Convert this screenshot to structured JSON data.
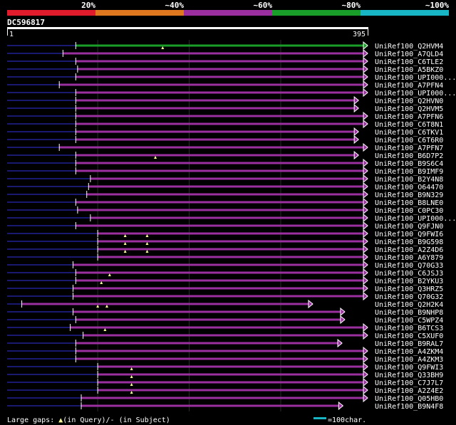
{
  "header": {
    "pct_labels": [
      "20%",
      "~40%",
      "~60%",
      "~80%",
      "~100%"
    ],
    "pct_colors": [
      "#e01b2c",
      "#e07820",
      "#9b2fa0",
      "#1a9e2a",
      "#18b5c5"
    ],
    "query_id": "DC596817",
    "ruler_start": "1",
    "ruler_end": "395"
  },
  "footer": {
    "gaps_prefix": "Large gaps: ",
    "gaps_query": "(in Query)/",
    "gaps_dash": "-",
    "gaps_subject": " (in Subject)",
    "scale_label": "=100char."
  },
  "colors": {
    "hit": "#9b2fa0",
    "best": "#1a9e2a",
    "dim": "#191970",
    "gap": "#ffff99",
    "scale": "#18b5c5"
  },
  "query_length": 395,
  "hits": [
    {
      "name": "UniRef100_Q2HVM4",
      "start": 76,
      "end": 395,
      "gaps": [
        171
      ],
      "best": true
    },
    {
      "name": "UniRef100_A7QLD4",
      "start": 62,
      "end": 395,
      "gaps": []
    },
    {
      "name": "UniRef100_C6TLE2",
      "start": 76,
      "end": 395,
      "gaps": []
    },
    {
      "name": "UniRef100_A5BKZ0",
      "start": 78,
      "end": 395,
      "gaps": []
    },
    {
      "name": "UniRef100_UPI000...",
      "start": 76,
      "end": 395,
      "gaps": []
    },
    {
      "name": "UniRef100_A7PFN4",
      "start": 58,
      "end": 395,
      "gaps": []
    },
    {
      "name": "UniRef100_UPI000...",
      "start": 76,
      "end": 395,
      "gaps": []
    },
    {
      "name": "UniRef100_Q2HVN0",
      "start": 76,
      "end": 385,
      "gaps": []
    },
    {
      "name": "UniRef100_Q2HVM5",
      "start": 76,
      "end": 385,
      "gaps": []
    },
    {
      "name": "UniRef100_A7PFN6",
      "start": 76,
      "end": 395,
      "gaps": []
    },
    {
      "name": "UniRef100_C6T8N1",
      "start": 76,
      "end": 395,
      "gaps": []
    },
    {
      "name": "UniRef100_C6TKV1",
      "start": 76,
      "end": 385,
      "gaps": []
    },
    {
      "name": "UniRef100_C6T6R0",
      "start": 76,
      "end": 385,
      "gaps": []
    },
    {
      "name": "UniRef100_A7PFN7",
      "start": 58,
      "end": 395,
      "gaps": []
    },
    {
      "name": "UniRef100_B6D7P2",
      "start": 76,
      "end": 385,
      "gaps": [
        163
      ]
    },
    {
      "name": "UniRef100_B9S6C4",
      "start": 76,
      "end": 395,
      "gaps": []
    },
    {
      "name": "UniRef100_B9IMF9",
      "start": 76,
      "end": 395,
      "gaps": []
    },
    {
      "name": "UniRef100_B2Y4N8",
      "start": 92,
      "end": 395,
      "gaps": []
    },
    {
      "name": "UniRef100_O64470",
      "start": 90,
      "end": 395,
      "gaps": []
    },
    {
      "name": "UniRef100_B9N329",
      "start": 88,
      "end": 395,
      "gaps": []
    },
    {
      "name": "UniRef100_B8LNE0",
      "start": 76,
      "end": 395,
      "gaps": []
    },
    {
      "name": "UniRef100_C0PC30",
      "start": 78,
      "end": 395,
      "gaps": []
    },
    {
      "name": "UniRef100_UPI000...",
      "start": 92,
      "end": 395,
      "gaps": []
    },
    {
      "name": "UniRef100_Q9FJN0",
      "start": 76,
      "end": 395,
      "gaps": []
    },
    {
      "name": "UniRef100_Q9FWI6",
      "start": 100,
      "end": 395,
      "gaps": [
        130,
        154
      ]
    },
    {
      "name": "UniRef100_B9G598",
      "start": 100,
      "end": 395,
      "gaps": [
        130,
        154
      ]
    },
    {
      "name": "UniRef100_A2Z4D6",
      "start": 100,
      "end": 395,
      "gaps": [
        130,
        154
      ]
    },
    {
      "name": "UniRef100_A6Y879",
      "start": 100,
      "end": 395,
      "gaps": []
    },
    {
      "name": "UniRef100_Q70G33",
      "start": 73,
      "end": 395,
      "gaps": []
    },
    {
      "name": "UniRef100_C6JSJ3",
      "start": 76,
      "end": 395,
      "gaps": [
        113
      ]
    },
    {
      "name": "UniRef100_B2YKU3",
      "start": 76,
      "end": 395,
      "gaps": [
        104
      ]
    },
    {
      "name": "UniRef100_Q3HRZ5",
      "start": 73,
      "end": 395,
      "gaps": []
    },
    {
      "name": "UniRef100_Q70G32",
      "start": 73,
      "end": 395,
      "gaps": []
    },
    {
      "name": "UniRef100_Q2H2K4",
      "start": 17,
      "end": 335,
      "gaps": [
        100,
        110
      ]
    },
    {
      "name": "UniRef100_B9NHP8",
      "start": 73,
      "end": 370,
      "gaps": []
    },
    {
      "name": "UniRef100_C5WPZ4",
      "start": 76,
      "end": 370,
      "gaps": []
    },
    {
      "name": "UniRef100_B6TCS3",
      "start": 70,
      "end": 395,
      "gaps": [
        108
      ]
    },
    {
      "name": "UniRef100_C5XUF0",
      "start": 84,
      "end": 395,
      "gaps": []
    },
    {
      "name": "UniRef100_B9RAL7",
      "start": 76,
      "end": 367,
      "gaps": []
    },
    {
      "name": "UniRef100_A4ZKM4",
      "start": 76,
      "end": 395,
      "gaps": []
    },
    {
      "name": "UniRef100_A4ZKM3",
      "start": 76,
      "end": 395,
      "gaps": []
    },
    {
      "name": "UniRef100_Q9FWI3",
      "start": 100,
      "end": 395,
      "gaps": [
        137
      ]
    },
    {
      "name": "UniRef100_Q33BH9",
      "start": 100,
      "end": 395,
      "gaps": [
        137
      ]
    },
    {
      "name": "UniRef100_C7J7L7",
      "start": 100,
      "end": 395,
      "gaps": [
        137
      ]
    },
    {
      "name": "UniRef100_A2Z4E2",
      "start": 100,
      "end": 395,
      "gaps": [
        137
      ]
    },
    {
      "name": "UniRef100_Q05HB0",
      "start": 82,
      "end": 395,
      "gaps": []
    },
    {
      "name": "UniRef100_B9N4F8",
      "start": 82,
      "end": 368,
      "gaps": []
    }
  ]
}
